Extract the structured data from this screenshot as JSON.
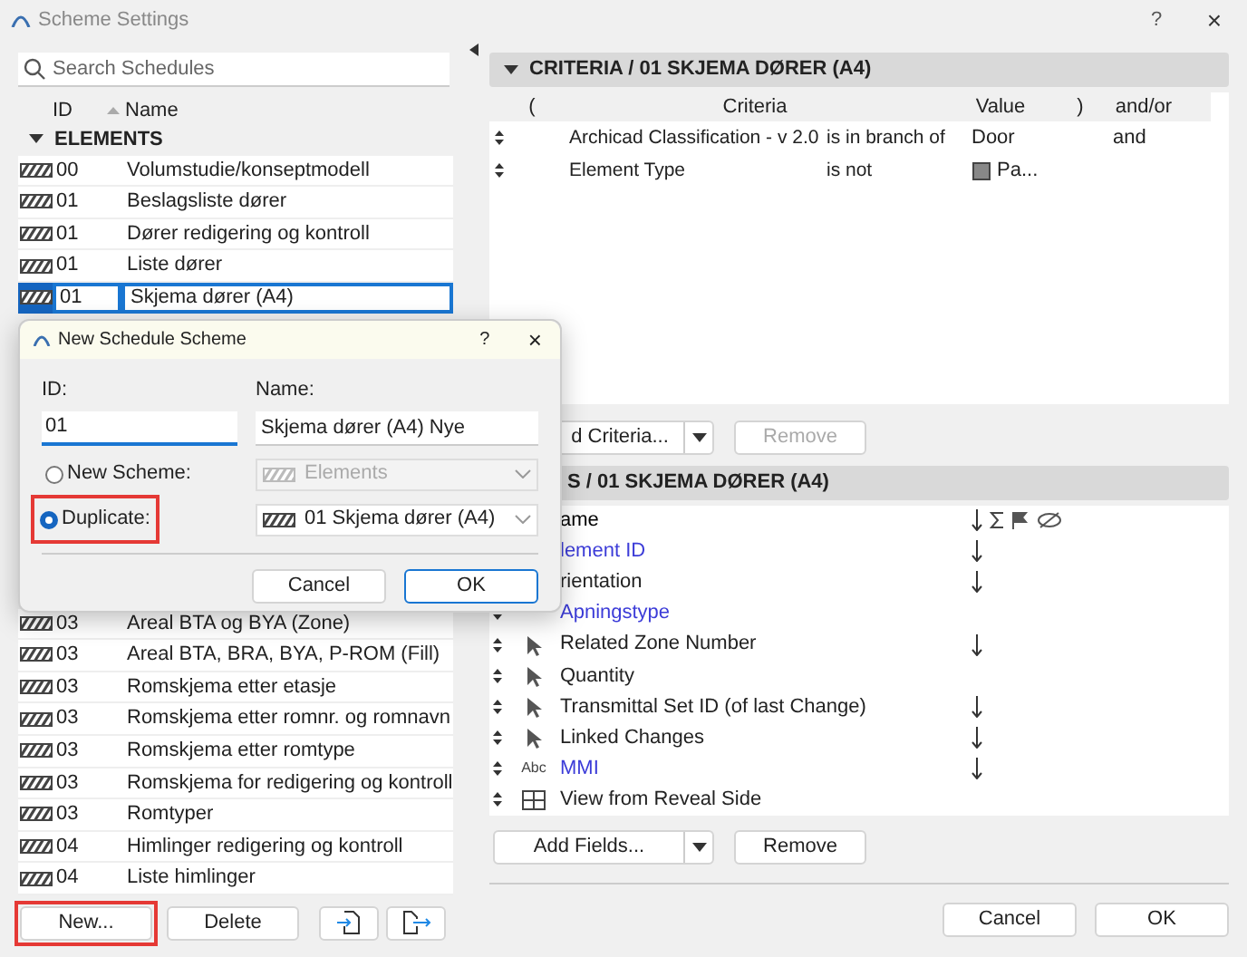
{
  "window": {
    "title": "Scheme Settings",
    "help": "?",
    "close": "×"
  },
  "search": {
    "placeholder": "Search Schedules"
  },
  "schedule_list": {
    "columns": [
      "ID",
      "Name"
    ],
    "group": {
      "label": "ELEMENTS",
      "expanded": true
    },
    "rows_above_dialog": [
      {
        "id": "00",
        "name": "Volumstudie/konseptmodell",
        "selected": false
      },
      {
        "id": "01",
        "name": "Beslagsliste dører",
        "selected": false
      },
      {
        "id": "01",
        "name": "Dører redigering og kontroll",
        "selected": false
      },
      {
        "id": "01",
        "name": "Liste dører",
        "selected": false
      },
      {
        "id": "01",
        "name": "Skjema dører (A4)",
        "selected": true
      }
    ],
    "rows_below_dialog": [
      {
        "id": "03",
        "name": "Areal BTA og BYA (Zone)",
        "selected": false
      },
      {
        "id": "03",
        "name": "Areal BTA, BRA, BYA, P-ROM (Fill)",
        "selected": false
      },
      {
        "id": "03",
        "name": "Romskjema etter etasje",
        "selected": false
      },
      {
        "id": "03",
        "name": "Romskjema etter romnr. og romnavn",
        "selected": false
      },
      {
        "id": "03",
        "name": "Romskjema etter romtype",
        "selected": false
      },
      {
        "id": "03",
        "name": "Romskjema for redigering og kontroll",
        "selected": false
      },
      {
        "id": "03",
        "name": "Romtyper",
        "selected": false
      },
      {
        "id": "04",
        "name": "Himlinger redigering og kontroll",
        "selected": false
      },
      {
        "id": "04",
        "name": "Liste himlinger",
        "selected": false
      }
    ]
  },
  "list_buttons": [
    {
      "label": "New...",
      "highlighted": true
    },
    {
      "label": "Delete",
      "highlighted": false
    }
  ],
  "criteria": {
    "title": "CRITERIA / 01 SKJEMA DØRER (A4)",
    "expanded": true,
    "columns": [
      "(",
      "Criteria",
      "Value",
      ")",
      "and/or"
    ],
    "rows": [
      {
        "criteria": "Archicad Classification - v 2.0",
        "operator": "is in branch of",
        "value": "Door",
        "andor": "and"
      },
      {
        "criteria": "Element Type",
        "operator": "is not",
        "value": "Pa...",
        "kind": "element-type"
      }
    ],
    "buttons": [
      {
        "label": "d Criteria...",
        "disabled": false,
        "split": true
      },
      {
        "label": "Remove",
        "disabled": true,
        "split": false
      }
    ]
  },
  "fields": {
    "title": "S / 01 SKJEMA DØRER (A4)",
    "name_column": "ame",
    "rows": [
      {
        "name": "lement ID",
        "color": "#3c3cd8",
        "sorted": true
      },
      {
        "name": "rientation",
        "color": "#222222",
        "sorted": true
      },
      {
        "name": "Apningstype",
        "color": "#3c3cd8",
        "sorted": false,
        "kind": "covered"
      },
      {
        "name": "Related Zone Number",
        "color": "#222222",
        "sorted": true,
        "kind": "pointer"
      },
      {
        "name": "Quantity",
        "color": "#222222",
        "sorted": false,
        "kind": "pointer"
      },
      {
        "name": "Transmittal Set ID (of last Change)",
        "color": "#222222",
        "sorted": true,
        "kind": "pointer"
      },
      {
        "name": "Linked Changes",
        "color": "#222222",
        "sorted": true,
        "kind": "pointer"
      },
      {
        "name": "MMI",
        "color": "#3c3cd8",
        "sorted": true,
        "kind": "text",
        "type_label": "Abc"
      },
      {
        "name": "View from Reveal Side",
        "color": "#222222",
        "sorted": false,
        "kind": "grid"
      }
    ],
    "buttons": [
      {
        "label": "Add Fields...",
        "disabled": false,
        "split": true
      },
      {
        "label": "Remove",
        "disabled": false,
        "split": false
      }
    ]
  },
  "footer_buttons": [
    {
      "label": "Cancel",
      "default": false
    },
    {
      "label": "OK",
      "default": false
    }
  ],
  "dialog": {
    "title": "New Schedule Scheme",
    "help": "?",
    "close": "×",
    "id_label": "ID:",
    "id_value": "01",
    "name_label": "Name:",
    "name_value": "Skjema dører (A4) Nye",
    "options": [
      {
        "label": "New Scheme:",
        "selected": false,
        "highlighted": false,
        "dropdown": {
          "value": "Elements",
          "disabled": true
        }
      },
      {
        "label": "Duplicate:",
        "selected": true,
        "highlighted": true,
        "dropdown": {
          "value": "01 Skjema dører (A4)",
          "disabled": false
        }
      }
    ],
    "buttons": [
      {
        "label": "Cancel",
        "default": false
      },
      {
        "label": "OK",
        "default": true
      }
    ]
  }
}
